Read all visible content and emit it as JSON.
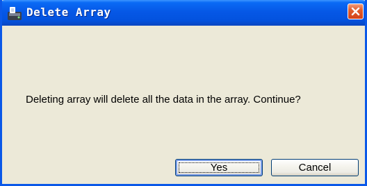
{
  "window": {
    "title": "Delete Array",
    "title_icon": "disk-array-icon",
    "close_icon": "close-icon",
    "accent_color": "#0a58e8",
    "close_color": "#e15d2c"
  },
  "dialog": {
    "message": "Deleting array will delete all the data in the array. Continue?",
    "yes_label": "Yes",
    "cancel_label": "Cancel"
  }
}
